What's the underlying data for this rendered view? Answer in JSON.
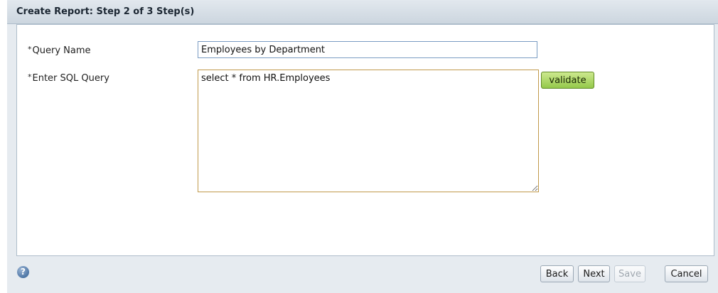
{
  "header": {
    "title": "Create Report: Step 2 of 3 Step(s)"
  },
  "form": {
    "required_marker": "*",
    "query_name_label": "Query Name",
    "query_name_value": "Employees by Department",
    "sql_label": "Enter SQL Query",
    "sql_value": "select * from HR.Employees",
    "validate_label": "validate"
  },
  "footer": {
    "help_glyph": "?",
    "back_label": "Back",
    "next_label": "Next",
    "save_label": "Save",
    "cancel_label": "Cancel",
    "save_disabled": true
  },
  "colors": {
    "validate_button": "#94c94a",
    "help_icon": "#2f5d93",
    "sql_border": "#c19a4b"
  },
  "icons": {
    "help": "help-icon"
  }
}
